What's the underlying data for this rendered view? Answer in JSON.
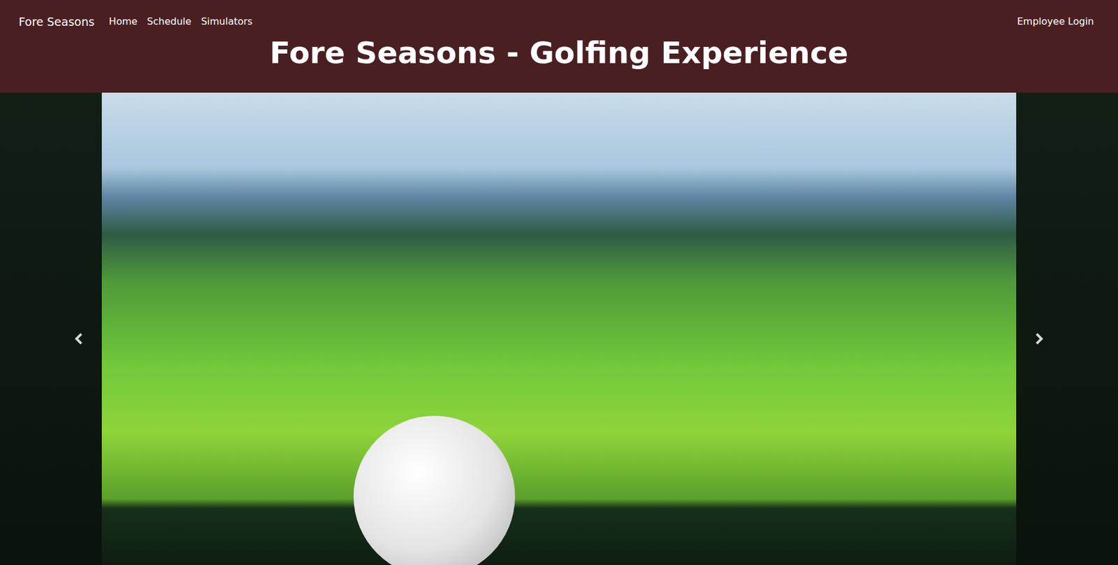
{
  "brand": "Fore Seasons",
  "nav": {
    "items": [
      {
        "label": "Home"
      },
      {
        "label": "Schedule"
      },
      {
        "label": "Simulators"
      }
    ],
    "login": "Employee Login"
  },
  "header": {
    "title": "Fore Seasons - Golfing Experience"
  }
}
